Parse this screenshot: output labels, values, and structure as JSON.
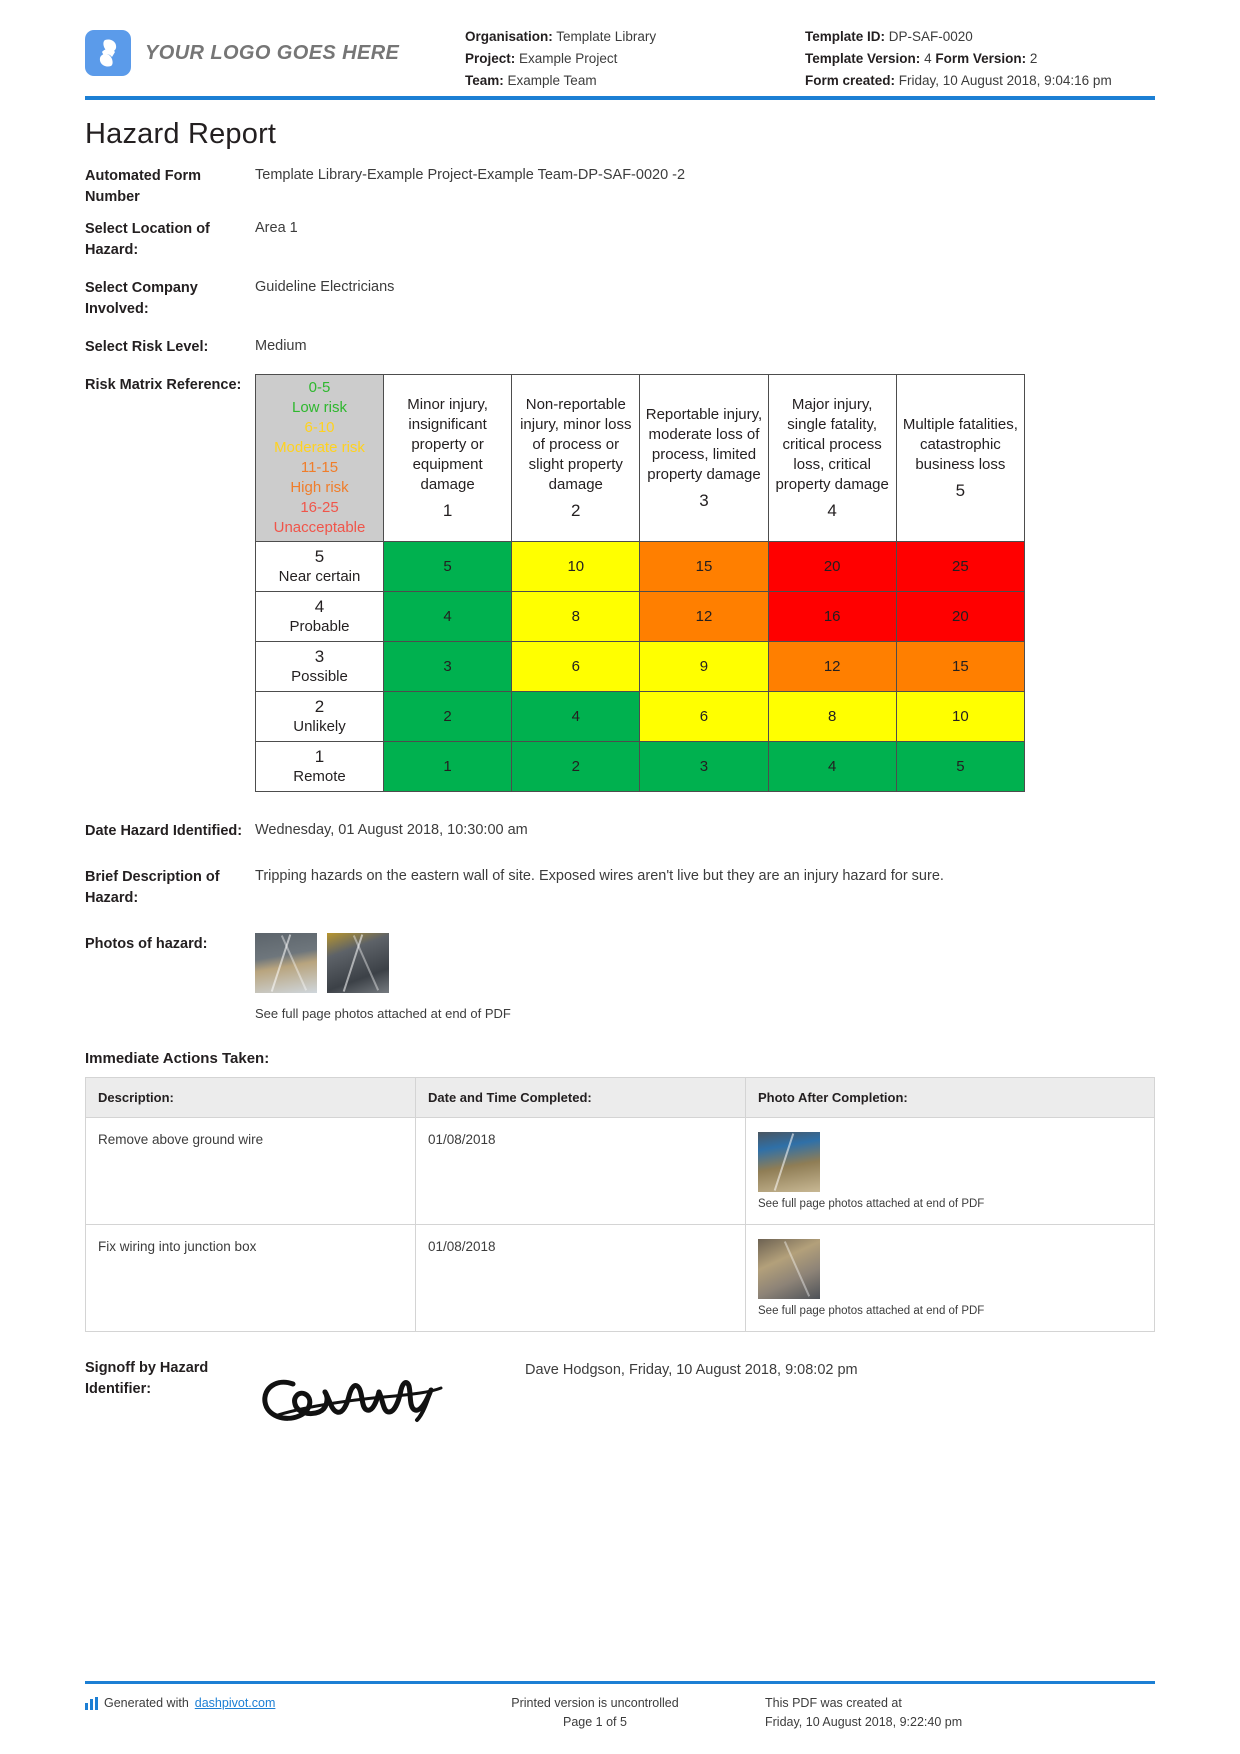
{
  "header": {
    "logo_text": "YOUR LOGO GOES HERE",
    "left_meta": [
      {
        "label": "Organisation:",
        "value": "Template Library"
      },
      {
        "label": "Project:",
        "value": "Example Project"
      },
      {
        "label": "Team:",
        "value": "Example Team"
      }
    ],
    "right_meta": [
      {
        "label": "Template ID:",
        "value": "DP-SAF-0020"
      },
      {
        "label": "Template Version:",
        "value": "4",
        "label2": "Form Version:",
        "value2": "2"
      },
      {
        "label": "Form created:",
        "value": "Friday, 10 August 2018, 9:04:16 pm"
      }
    ],
    "accent_color": "#1c7fd4"
  },
  "document": {
    "title": "Hazard Report"
  },
  "fields": [
    {
      "label": "Automated Form Number",
      "value": "Template Library-Example Project-Example Team-DP-SAF-0020   -2"
    },
    {
      "label": "Select Location of Hazard:",
      "value": "Area 1"
    },
    {
      "label": "Select Company Involved:",
      "value": "Guideline Electricians"
    },
    {
      "label": "Select Risk Level:",
      "value": "Medium"
    },
    {
      "label": "Risk Matrix Reference:",
      "value": ""
    },
    {
      "label": "Date Hazard Identified:",
      "value": "Wednesday, 01 August 2018, 10:30:00 am"
    },
    {
      "label": "Brief Description of Hazard:",
      "value": "Tripping hazards on the eastern wall of site. Exposed wires aren't live but they are an injury hazard for sure."
    },
    {
      "label": "Photos of hazard:",
      "value": ""
    }
  ],
  "risk_matrix": {
    "legend": [
      {
        "range": "0-5",
        "label": "Low risk",
        "color": "#2eb82e"
      },
      {
        "range": "6-10",
        "label": "Moderate risk",
        "color": "#ffd21f"
      },
      {
        "range": "11-15",
        "label": "High risk",
        "color": "#f07d2a"
      },
      {
        "range": "16-25",
        "label": "Unacceptable",
        "color": "#f0554a"
      }
    ],
    "consequence_headers": [
      {
        "text": "Minor injury, insignificant property or equipment damage",
        "index": "1"
      },
      {
        "text": "Non-reportable injury, minor loss of process or slight property damage",
        "index": "2"
      },
      {
        "text": "Reportable injury, moderate loss of process, limited property damage",
        "index": "3"
      },
      {
        "text": "Major injury, single fatality, critical process loss, critical property damage",
        "index": "4"
      },
      {
        "text": "Multiple fatalities, catastrophic business loss",
        "index": "5"
      }
    ],
    "likelihood_rows": [
      {
        "num": "5",
        "label": "Near certain",
        "cells": [
          {
            "value": "5",
            "color": "green"
          },
          {
            "value": "10",
            "color": "yellow"
          },
          {
            "value": "15",
            "color": "orange"
          },
          {
            "value": "20",
            "color": "red"
          },
          {
            "value": "25",
            "color": "red"
          }
        ]
      },
      {
        "num": "4",
        "label": "Probable",
        "cells": [
          {
            "value": "4",
            "color": "green"
          },
          {
            "value": "8",
            "color": "yellow"
          },
          {
            "value": "12",
            "color": "orange"
          },
          {
            "value": "16",
            "color": "red"
          },
          {
            "value": "20",
            "color": "red"
          }
        ]
      },
      {
        "num": "3",
        "label": "Possible",
        "cells": [
          {
            "value": "3",
            "color": "green"
          },
          {
            "value": "6",
            "color": "yellow"
          },
          {
            "value": "9",
            "color": "yellow"
          },
          {
            "value": "12",
            "color": "orange"
          },
          {
            "value": "15",
            "color": "orange"
          }
        ]
      },
      {
        "num": "2",
        "label": "Unlikely",
        "cells": [
          {
            "value": "2",
            "color": "green"
          },
          {
            "value": "4",
            "color": "green"
          },
          {
            "value": "6",
            "color": "yellow"
          },
          {
            "value": "8",
            "color": "yellow"
          },
          {
            "value": "10",
            "color": "yellow"
          }
        ]
      },
      {
        "num": "1",
        "label": "Remote",
        "cells": [
          {
            "value": "1",
            "color": "green"
          },
          {
            "value": "2",
            "color": "green"
          },
          {
            "value": "3",
            "color": "green"
          },
          {
            "value": "4",
            "color": "green"
          },
          {
            "value": "5",
            "color": "green"
          }
        ]
      }
    ],
    "colors": {
      "green": "#00b14f",
      "yellow": "#ffff00",
      "orange": "#ff7f00",
      "red": "#ff0000",
      "legend_bg": "#cccccc"
    }
  },
  "hazard_photos": {
    "caption": "See full page photos attached at end of PDF",
    "count": 2
  },
  "actions_section": {
    "title": "Immediate Actions Taken:",
    "columns": [
      "Description:",
      "Date and Time Completed:",
      "Photo After Completion:"
    ],
    "rows": [
      {
        "description": "Remove above ground wire",
        "date": "01/08/2018",
        "photo_caption": "See full page photos attached at end of PDF"
      },
      {
        "description": "Fix wiring into junction box",
        "date": "01/08/2018",
        "photo_caption": "See full page photos attached at end of PDF"
      }
    ]
  },
  "signoff": {
    "label": "Signoff by Hazard Identifier:",
    "name_and_time": "Dave Hodgson, Friday, 10 August 2018, 9:08:02 pm"
  },
  "footer": {
    "generated_prefix": "Generated with ",
    "generated_link": "dashpivot.com",
    "printed_line1": "Printed version is uncontrolled",
    "printed_line2": "Page 1 of 5",
    "created_line1": "This PDF was created at",
    "created_line2": "Friday, 10 August 2018, 9:22:40 pm"
  }
}
